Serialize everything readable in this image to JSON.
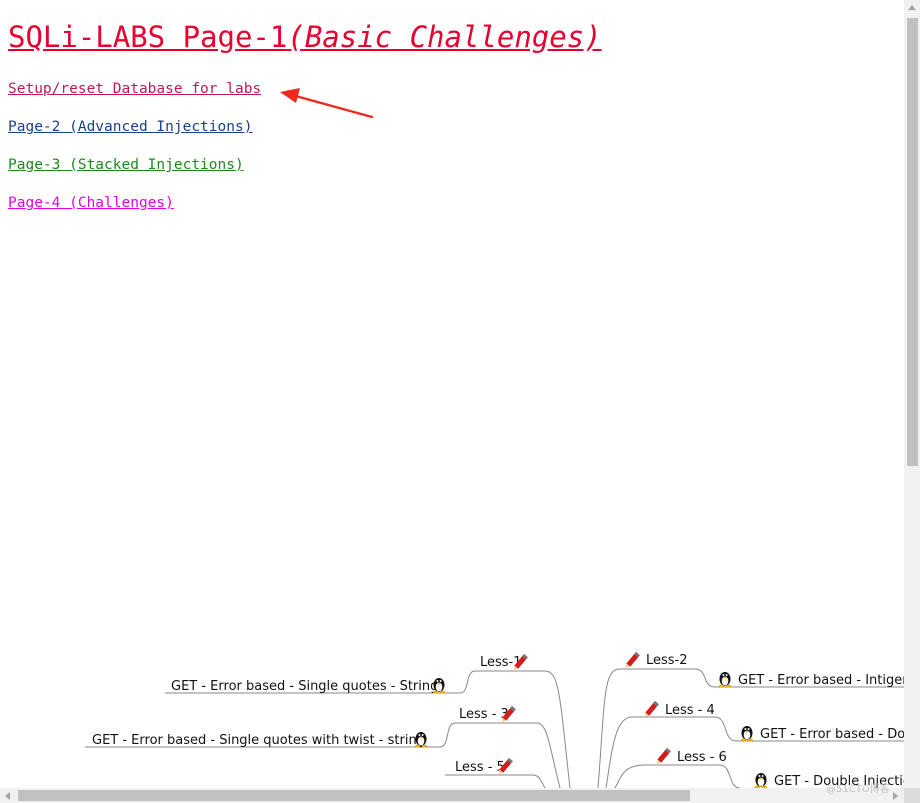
{
  "page": {
    "title_main": "SQLi-LABS Page-1",
    "title_sub": "(Basic Challenges)"
  },
  "links": {
    "setup": "Setup/reset Database for labs",
    "page2": "Page-2 (Advanced Injections)",
    "page3": "Page-3 (Stacked Injections)",
    "page4": "Page-4 (Challenges)"
  },
  "colors": {
    "title": "#e8002e",
    "setup_link": "#c2185b",
    "page2_link": "#1a3f8c",
    "page3_link": "#1b8a1b",
    "page4_link": "#e600e6",
    "annotation_arrow": "#f0281e"
  },
  "mindmap": {
    "left": [
      {
        "less": "Less-1",
        "desc": "GET - Error based - Single quotes - String"
      },
      {
        "less": "Less - 3",
        "desc": "GET - Error based - Single quotes with twist - string"
      },
      {
        "less": "Less - 5",
        "desc": ""
      }
    ],
    "right": [
      {
        "less": "Less-2",
        "desc": "GET - Error based - Intiger"
      },
      {
        "less": "Less - 4",
        "desc": "GET - Error based - Dou"
      },
      {
        "less": "Less - 6",
        "desc": "GET - Double Injectio"
      }
    ],
    "icons": {
      "less": "pencil-icon",
      "desc": "linux-penguin-icon"
    }
  },
  "watermark": "@51CTO博客"
}
